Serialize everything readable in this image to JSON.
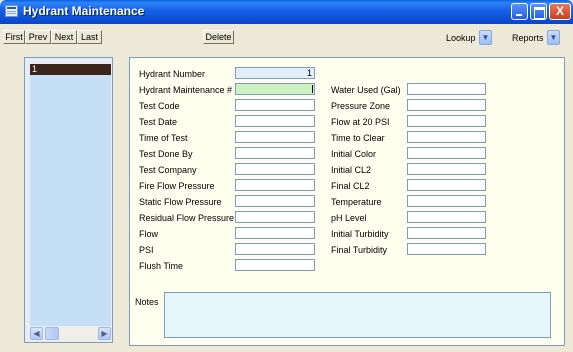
{
  "window": {
    "title": "Hydrant Maintenance",
    "controls": {
      "minimize": "minimize",
      "maximize": "maximize",
      "close": "X"
    }
  },
  "toolbar": {
    "first": "First",
    "prev": "Prev",
    "next": "Next",
    "last": "Last",
    "delete": "Delete",
    "lookup": "Lookup",
    "reports": "Reports"
  },
  "record_list": {
    "items": [
      "1"
    ]
  },
  "form": {
    "hydrant_number_label": "Hydrant Number",
    "hydrant_number_value": "1",
    "maintenance_no_label": "Hydrant Maintenance #",
    "left_fields": [
      "Test Code",
      "Test Date",
      "Time of Test",
      "Test Done By",
      "Test Company",
      "Fire Flow Pressure",
      "Static Flow Pressure",
      "Residual Flow Pressure",
      "Flow",
      "PSI",
      "Flush Time"
    ],
    "right_fields": [
      "Water Used (Gal)",
      "Pressure Zone",
      "Flow at 20 PSI",
      "Time to Clear",
      "Initial Color",
      "Initial CL2",
      "Final CL2",
      "Temperature",
      "pH Level",
      "Initial Turbidity",
      "Final Turbidity"
    ],
    "notes_label": "Notes"
  },
  "colors": {
    "title_bar": "#0B4FD6",
    "form_background": "#FFFFF0",
    "list_background": "#C4DFF6",
    "selected_row": "#3A241B",
    "highlight_field": "#CCF2C4",
    "notes_background": "#E6F6FD"
  },
  "icons": {
    "app": "form-window-icon",
    "dropdown": "chevron-down-icon",
    "scroll_left": "chevron-left-icon",
    "scroll_right": "chevron-right-icon"
  }
}
